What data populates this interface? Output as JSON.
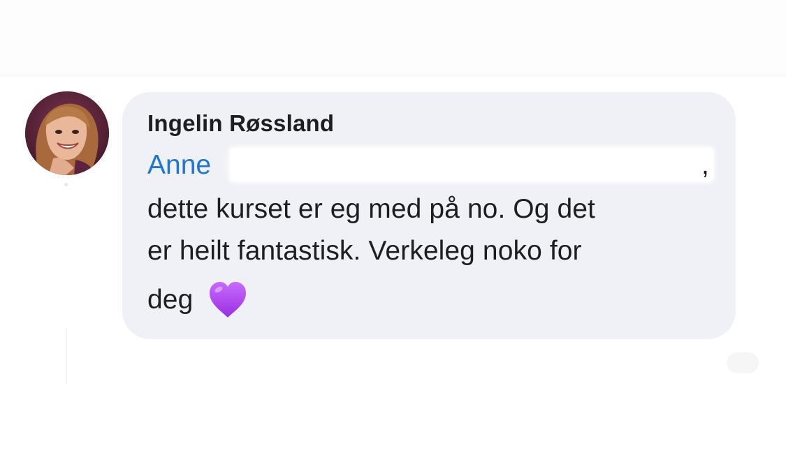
{
  "comment": {
    "author": "Ingelin Røssland",
    "mention": "Anne",
    "punctuation": ",",
    "lines": [
      "dette kurset er eg med på no. Og det",
      "er heilt fantastisk. Verkeleg noko for",
      "deg"
    ],
    "emoji": "purple-heart-icon",
    "colors": {
      "bubble": "#f0f1f6",
      "mention": "#2074d4",
      "text": "#1c1e21",
      "heart": "#b14cf0"
    }
  }
}
